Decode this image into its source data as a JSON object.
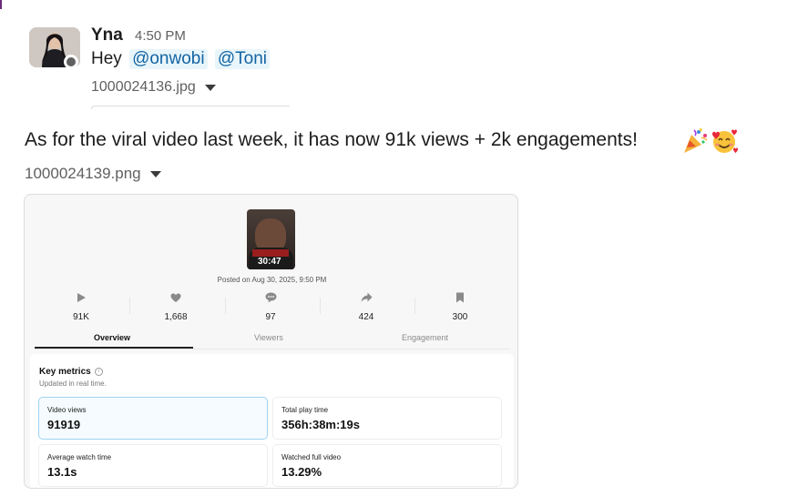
{
  "message1": {
    "author": "Yna",
    "timestamp": "4:50 PM",
    "greeting": "Hey",
    "mentions": [
      "@onwobi",
      "@Toni"
    ],
    "attachment_name": "1000024136.jpg"
  },
  "message2": {
    "text": "As for the viral video last week, it has now 91k views + 2k engagements!",
    "emojis": [
      "party-popper-icon",
      "smiling-face-with-hearts-icon"
    ],
    "attachment_name": "1000024139.png"
  },
  "screenshot": {
    "thumbnail_duration": "30:47",
    "posted": "Posted on Aug 30, 2025, 9:50 PM",
    "stats": [
      {
        "icon": "play-icon",
        "value": "91K"
      },
      {
        "icon": "heart-icon",
        "value": "1,668"
      },
      {
        "icon": "comment-icon",
        "value": "97"
      },
      {
        "icon": "share-icon",
        "value": "424"
      },
      {
        "icon": "bookmark-icon",
        "value": "300"
      }
    ],
    "tabs": [
      "Overview",
      "Viewers",
      "Engagement"
    ],
    "active_tab": "Overview",
    "key_metrics": {
      "title": "Key metrics",
      "subtitle": "Updated in real time.",
      "items": [
        {
          "label": "Video views",
          "value": "91919"
        },
        {
          "label": "Total play time",
          "value": "356h:38m:19s"
        },
        {
          "label": "Average watch time",
          "value": "13.1s"
        },
        {
          "label": "Watched full video",
          "value": "13.29%"
        }
      ]
    }
  },
  "colors": {
    "mention_bg": "#e8f5fa",
    "mention_text": "#1264a3",
    "selected_border": "#9fd3ef"
  }
}
